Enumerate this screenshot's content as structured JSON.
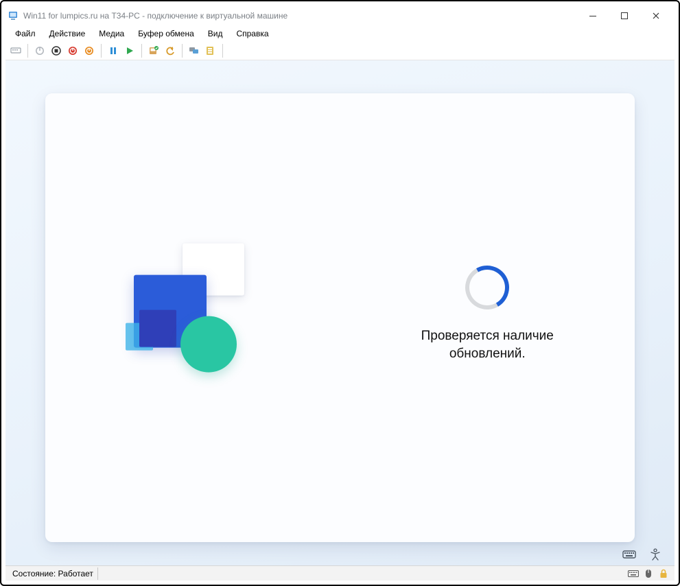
{
  "window": {
    "title": "Win11 for lumpics.ru на T34-PC - подключение к виртуальной машине"
  },
  "menu": {
    "items": [
      "Файл",
      "Действие",
      "Медиа",
      "Буфер обмена",
      "Вид",
      "Справка"
    ]
  },
  "toolbar": {
    "icons": [
      "ctrl-alt-del-icon",
      "power-off-icon",
      "stop-icon",
      "shutdown-icon",
      "reset-icon",
      "pause-icon",
      "start-icon",
      "checkpoint-icon",
      "revert-icon",
      "enhanced-session-icon",
      "share-icon"
    ]
  },
  "oobe": {
    "status_text": "Проверяется наличие\nобновлений."
  },
  "viewport_corner": {
    "keyboard_icon": "keyboard-icon",
    "accessibility_icon": "accessibility-icon"
  },
  "statusbar": {
    "state_label": "Состояние: Работает",
    "tray_icons": [
      "keyboard-tray-icon",
      "mouse-tray-icon",
      "lock-tray-icon"
    ]
  }
}
